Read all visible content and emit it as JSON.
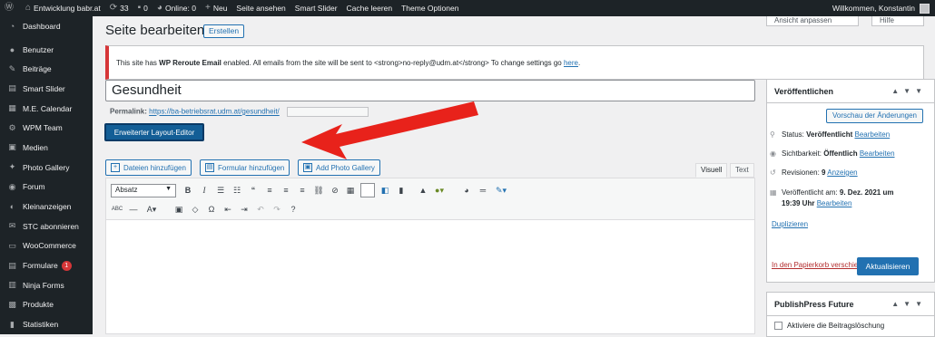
{
  "adminbar": {
    "site_name": "Entwicklung babr.at",
    "updates_count": "33",
    "comments_count": "0",
    "online": "Online: 0",
    "new": "Neu",
    "view_page": "Seite ansehen",
    "smart_slider": "Smart Slider",
    "clear_cache": "Cache leeren",
    "theme_options": "Theme Optionen",
    "greeting": "Willkommen, Konstantin"
  },
  "screen_options": {
    "view": "Ansicht anpassen",
    "help": "Hilfe"
  },
  "sidebar": {
    "items": [
      {
        "label": "Dashboard",
        "icon": "dashboard-icon",
        "glyph": "◔"
      },
      {
        "label": "Benutzer",
        "icon": "users-icon",
        "glyph": "●"
      },
      {
        "label": "Beiträge",
        "icon": "pin-icon",
        "glyph": "✎"
      },
      {
        "label": "Smart Slider",
        "icon": "slider-icon",
        "glyph": "▤"
      },
      {
        "label": "M.E. Calendar",
        "icon": "calendar-icon",
        "glyph": "▦"
      },
      {
        "label": "WPM Team",
        "icon": "team-icon",
        "glyph": "⚙"
      },
      {
        "label": "Medien",
        "icon": "media-icon",
        "glyph": "▣"
      },
      {
        "label": "Photo Gallery",
        "icon": "gallery-icon",
        "glyph": "✦"
      },
      {
        "label": "Forum",
        "icon": "forum-icon",
        "glyph": "◉"
      },
      {
        "label": "Kleinanzeigen",
        "icon": "ads-icon",
        "glyph": "◐"
      },
      {
        "label": "STC abonnieren",
        "icon": "mail-icon",
        "glyph": "✉"
      },
      {
        "label": "WooCommerce",
        "icon": "woo-icon",
        "glyph": "▭"
      },
      {
        "label": "Formulare",
        "icon": "forms-icon",
        "glyph": "▤",
        "badge": "1"
      },
      {
        "label": "Ninja Forms",
        "icon": "ninja-icon",
        "glyph": "▥"
      },
      {
        "label": "Produkte",
        "icon": "products-icon",
        "glyph": "▩"
      },
      {
        "label": "Statistiken",
        "icon": "stats-icon",
        "glyph": "▮"
      }
    ]
  },
  "page": {
    "title": "Seite bearbeiten",
    "create_button": "Erstellen",
    "notice_pre": "This site has ",
    "notice_strong": "WP Reroute Email",
    "notice_post": " enabled. All emails from the site will be sent to <strong>no-reply@udm.at</strong> To change settings go ",
    "notice_link": "here",
    "notice_end": ".",
    "post_title": "Gesundheit",
    "permalink_label": "Permalink:",
    "permalink_url": "https://ba-betriebsrat.udm.at/gesundheit/",
    "layout_editor_button": "Erweiterter Layout-Editor"
  },
  "media_buttons": [
    {
      "label": "Dateien hinzufügen",
      "icon": "add-media-icon"
    },
    {
      "label": "Formular hinzufügen",
      "icon": "add-form-icon"
    },
    {
      "label": "Add Photo Gallery",
      "icon": "add-gallery-icon"
    }
  ],
  "editor": {
    "tab_visual": "Visuell",
    "tab_text": "Text",
    "format_select": "Absatz"
  },
  "publish": {
    "heading": "Veröffentlichen",
    "preview_button": "Vorschau der Änderungen",
    "status_label": "Status: ",
    "status_value": "Veröffentlicht",
    "visibility_label": "Sichtbarkeit: ",
    "visibility_value": "Öffentlich",
    "revisions_label": "Revisionen: ",
    "revisions_value": "9",
    "revisions_link": "Anzeigen",
    "published_label": "Veröffentlicht am: ",
    "published_value_1": "9. Dez. 2021 um",
    "published_value_2": "19:39 Uhr",
    "edit_link": "Bearbeiten",
    "duplicate_link": "Duplizieren",
    "trash_link": "In den Papierkorb verschieben",
    "update_button": "Aktualisieren"
  },
  "future": {
    "heading": "PublishPress Future",
    "checkbox_label": "Aktiviere die Beitragslöschung"
  },
  "colors": {
    "admin_bar": "#1d2327",
    "accent": "#2271b1",
    "layout_button": "#135e96",
    "annotation_arrow": "#e8221b",
    "notice_border": "#d63638"
  }
}
